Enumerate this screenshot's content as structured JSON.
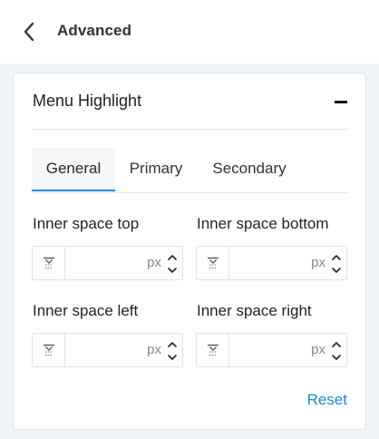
{
  "header": {
    "title": "Advanced",
    "back_icon": "chevron-left-icon"
  },
  "section": {
    "title": "Menu Highlight",
    "collapse_icon": "minus-icon"
  },
  "tabs": [
    {
      "label": "General",
      "active": true
    },
    {
      "label": "Primary",
      "active": false
    },
    {
      "label": "Secondary",
      "active": false
    }
  ],
  "fields": {
    "top": {
      "label": "Inner space top",
      "value": "",
      "unit": "px",
      "icon": "padding-top-icon"
    },
    "bottom": {
      "label": "Inner space bottom",
      "value": "",
      "unit": "px",
      "icon": "padding-bottom-icon"
    },
    "left": {
      "label": "Inner space left",
      "value": "",
      "unit": "px",
      "icon": "padding-left-icon"
    },
    "right": {
      "label": "Inner space right",
      "value": "",
      "unit": "px",
      "icon": "padding-right-icon"
    }
  },
  "actions": {
    "reset_label": "Reset"
  },
  "colors": {
    "accent": "#1a87e0",
    "background": "#f0f5f8",
    "panel": "#ffffff",
    "border": "#dfe3e7"
  }
}
